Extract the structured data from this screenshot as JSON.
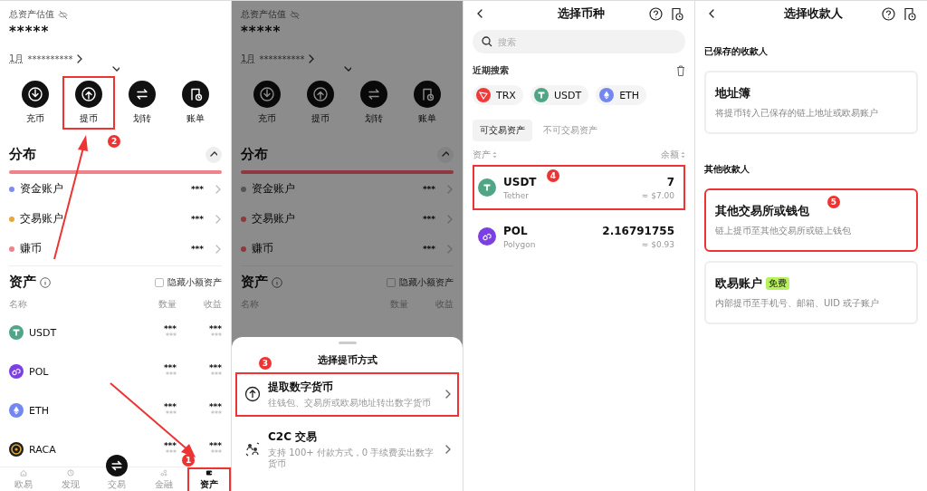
{
  "screens": [
    {
      "kind": "assets",
      "dimmed": false,
      "header": {
        "label": "总资产估值",
        "value": "*****",
        "period": "1月",
        "period_value": "**********"
      },
      "actions": [
        {
          "kind": "deposit",
          "label": "充币",
          "highlighted": false
        },
        {
          "kind": "withdraw",
          "label": "提币",
          "highlighted": true,
          "step": "2"
        },
        {
          "kind": "transfer",
          "label": "划转",
          "highlighted": false
        },
        {
          "kind": "bill",
          "label": "账单",
          "highlighted": false
        }
      ],
      "distribution": {
        "title": "分布",
        "accounts": [
          {
            "name": "资金账户",
            "color": "#7d8cf0",
            "value": "***"
          },
          {
            "name": "交易账户",
            "color": "#e2a93b",
            "value": "***"
          },
          {
            "name": "赚币",
            "color": "#f0838a",
            "value": "***"
          }
        ]
      },
      "assets": {
        "title": "资产",
        "hide_small_label": "隐藏小额资产",
        "hide_small_checked": false,
        "columns": [
          "名称",
          "数量",
          "收益"
        ],
        "rows": [
          {
            "symbol": "USDT",
            "kind": "tether",
            "color": "#4fa586",
            "amount": "***",
            "amount_sub": "***",
            "pnl": "***",
            "pnl_sub": "***"
          },
          {
            "symbol": "POL",
            "kind": "polygon",
            "color": "#7b3fe4",
            "amount": "***",
            "amount_sub": "***",
            "pnl": "***",
            "pnl_sub": "***"
          },
          {
            "symbol": "ETH",
            "kind": "ether",
            "color": "#7387f0",
            "amount": "***",
            "amount_sub": "***",
            "pnl": "***",
            "pnl_sub": "***"
          },
          {
            "symbol": "RACA",
            "kind": "raca",
            "color": "#1c1c1c",
            "amount": "***",
            "amount_sub": "***",
            "pnl": "***",
            "pnl_sub": "***"
          }
        ]
      },
      "nav": [
        {
          "kind": "home",
          "label": "欧易",
          "selected": false,
          "highlighted": false
        },
        {
          "kind": "discover",
          "label": "发现",
          "selected": false,
          "highlighted": false
        },
        {
          "kind": "trade",
          "label": "交易",
          "selected": false,
          "highlighted": false
        },
        {
          "kind": "finance",
          "label": "金融",
          "selected": false,
          "highlighted": false
        },
        {
          "kind": "wallet",
          "label": "资产",
          "selected": true,
          "highlighted": true,
          "step": "1"
        }
      ]
    },
    {
      "kind": "assets",
      "dimmed": true,
      "header": {
        "label": "总资产估值",
        "value": "*****",
        "period": "1月",
        "period_value": "**********"
      },
      "actions": [
        {
          "kind": "deposit",
          "label": "充币",
          "highlighted": false
        },
        {
          "kind": "withdraw",
          "label": "提币",
          "highlighted": false
        },
        {
          "kind": "transfer",
          "label": "划转",
          "highlighted": false
        },
        {
          "kind": "bill",
          "label": "账单",
          "highlighted": false
        }
      ],
      "distribution": {
        "title": "分布",
        "accounts": [
          {
            "name": "资金账户",
            "color": "#555558",
            "value": "***"
          },
          {
            "name": "交易账户",
            "color": "#8c3a3a",
            "value": "***"
          },
          {
            "name": "赚币",
            "color": "#8c3a40",
            "value": "***"
          }
        ]
      },
      "assets": {
        "title": "资产",
        "hide_small_label": "隐藏小额资产",
        "hide_small_checked": false,
        "columns": [
          "名称",
          "数量",
          "收益"
        ]
      },
      "sheet": {
        "title": "选择提币方式",
        "options": [
          {
            "kind": "upload",
            "title": "提取数字货币",
            "desc": "往钱包、交易所或欧易地址转出数字货币",
            "highlighted": true,
            "step": "3"
          },
          {
            "kind": "people",
            "title": "C2C 交易",
            "desc": "支持 100+ 付款方式，0 手续费卖出数字货币",
            "highlighted": false
          }
        ]
      }
    },
    {
      "kind": "coin_select",
      "title": "选择币种",
      "search": {
        "placeholder": "搜索"
      },
      "recent_title": "近期搜索",
      "recent": [
        {
          "symbol": "TRX",
          "kind": "tron",
          "color": "#ef3a3a"
        },
        {
          "symbol": "USDT",
          "kind": "tether",
          "color": "#4fa586"
        },
        {
          "symbol": "ETH",
          "kind": "ether",
          "color": "#7387f0"
        }
      ],
      "tabs": [
        {
          "label": "可交易资产",
          "selected": true
        },
        {
          "label": "不可交易资产",
          "selected": false
        }
      ],
      "columns": [
        "资产",
        "余额"
      ],
      "coins": [
        {
          "symbol": "USDT",
          "name": "Tether",
          "kind": "tether",
          "color": "#4fa586",
          "balance": "7",
          "value": "≈ $7.00",
          "highlighted": true,
          "step": "4"
        },
        {
          "symbol": "POL",
          "name": "Polygon",
          "kind": "polygon",
          "color": "#7b3fe4",
          "balance": "2.16791755",
          "value": "≈ $0.93",
          "highlighted": false
        }
      ]
    },
    {
      "kind": "recipient",
      "title": "选择收款人",
      "sections": [
        {
          "title": "已保存的收款人",
          "cards": [
            {
              "title": "地址簿",
              "desc": "将提币转入已保存的链上地址或欧易账户",
              "highlighted": false
            }
          ]
        },
        {
          "title": "其他收款人",
          "cards": [
            {
              "title": "其他交易所或钱包",
              "desc": "链上提币至其他交易所或链上钱包",
              "highlighted": true,
              "step": "5"
            },
            {
              "title": "欧易账户",
              "badge": "免费",
              "desc": "内部提币至手机号、邮箱、UID 或子账户",
              "highlighted": false
            }
          ]
        }
      ]
    }
  ]
}
